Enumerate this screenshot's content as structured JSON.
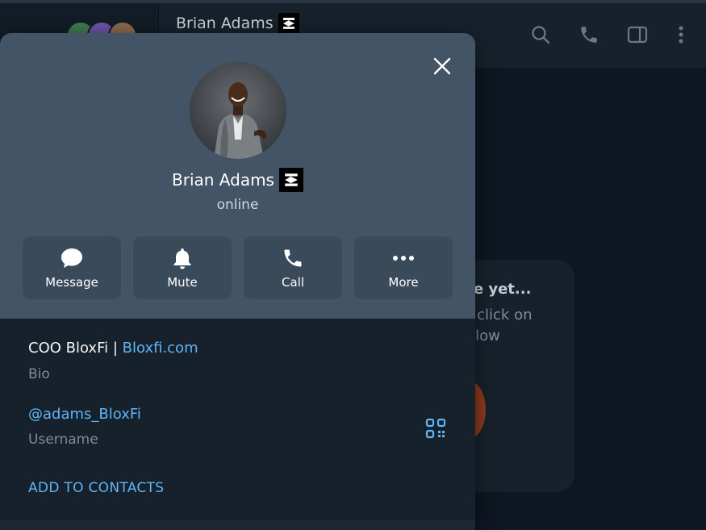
{
  "background": {
    "chat_title": "Brian Adams",
    "empty_card": {
      "line1": "re yet...",
      "line2": "r click on",
      "line3": "elow"
    },
    "header_icons": [
      "search-icon",
      "phone-icon",
      "sidebar-toggle-icon",
      "more-vertical-icon"
    ]
  },
  "profile": {
    "name": "Brian Adams",
    "status": "online",
    "actions": [
      {
        "label": "Message",
        "icon": "message-icon"
      },
      {
        "label": "Mute",
        "icon": "bell-icon"
      },
      {
        "label": "Call",
        "icon": "phone-icon"
      },
      {
        "label": "More",
        "icon": "more-horizontal-icon"
      }
    ],
    "bio_text": "COO BloxFi | ",
    "bio_link": "Bloxfi.com",
    "bio_label": "Bio",
    "username": "@adams_BloxFi",
    "username_label": "Username",
    "add_contacts": "ADD TO CONTACTS"
  },
  "colors": {
    "accent": "#5eb5f7",
    "modal_header": "#425466",
    "panel": "#17212b"
  }
}
